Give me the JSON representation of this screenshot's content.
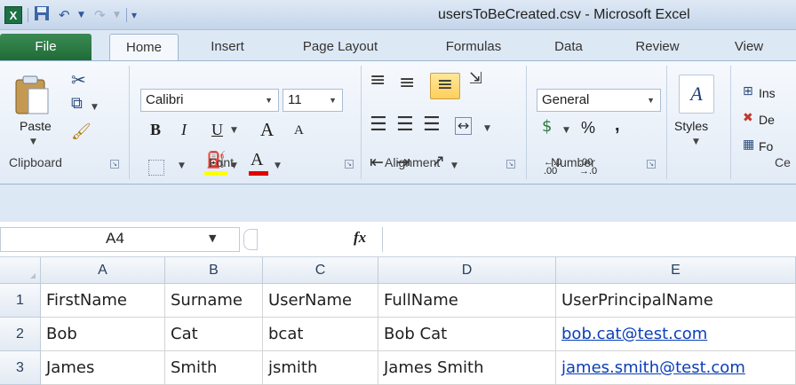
{
  "app": {
    "icon_letter": "X",
    "title": "usersToBeCreated.csv  -  Microsoft Excel"
  },
  "tabs": [
    {
      "label": "File"
    },
    {
      "label": "Home"
    },
    {
      "label": "Insert"
    },
    {
      "label": "Page Layout"
    },
    {
      "label": "Formulas"
    },
    {
      "label": "Data"
    },
    {
      "label": "Review"
    },
    {
      "label": "View"
    }
  ],
  "ribbon": {
    "clipboard": {
      "label": "Clipboard",
      "paste_label": "Paste"
    },
    "font": {
      "label": "Font",
      "font_name": "Calibri",
      "font_size": "11",
      "bold": "B",
      "italic": "I",
      "underline": "U",
      "grow": "A",
      "shrink": "A",
      "font_color": "A"
    },
    "alignment": {
      "label": "Alignment"
    },
    "number": {
      "label": "Number",
      "format": "General",
      "percent": "%",
      "comma": ",",
      "inc_decimal": "←.0 .00",
      "dec_decimal": ".00 →.0"
    },
    "styles": {
      "label": "Styles"
    },
    "cells": {
      "label": "Ce",
      "insert": "Ins",
      "delete": "De",
      "format": "Fo"
    }
  },
  "formula_bar": {
    "name_box": "A4",
    "fx": "fx",
    "value": ""
  },
  "grid": {
    "columns": [
      "A",
      "B",
      "C",
      "D",
      "E"
    ],
    "rows": [
      {
        "num": "1",
        "cells": [
          "FirstName",
          "Surname",
          "UserName",
          "FullName",
          "UserPrincipalName"
        ]
      },
      {
        "num": "2",
        "cells": [
          "Bob",
          "Cat",
          "bcat",
          "Bob Cat",
          "bob.cat@test.com"
        ]
      },
      {
        "num": "3",
        "cells": [
          "James",
          "Smith",
          "jsmith",
          "James Smith",
          "james.smith@test.com"
        ]
      }
    ]
  },
  "colors": {
    "accent": "#1d7044",
    "link": "#0b3fb8",
    "font_color_bar": "#e00000",
    "highlight_bar": "#ffff00"
  }
}
